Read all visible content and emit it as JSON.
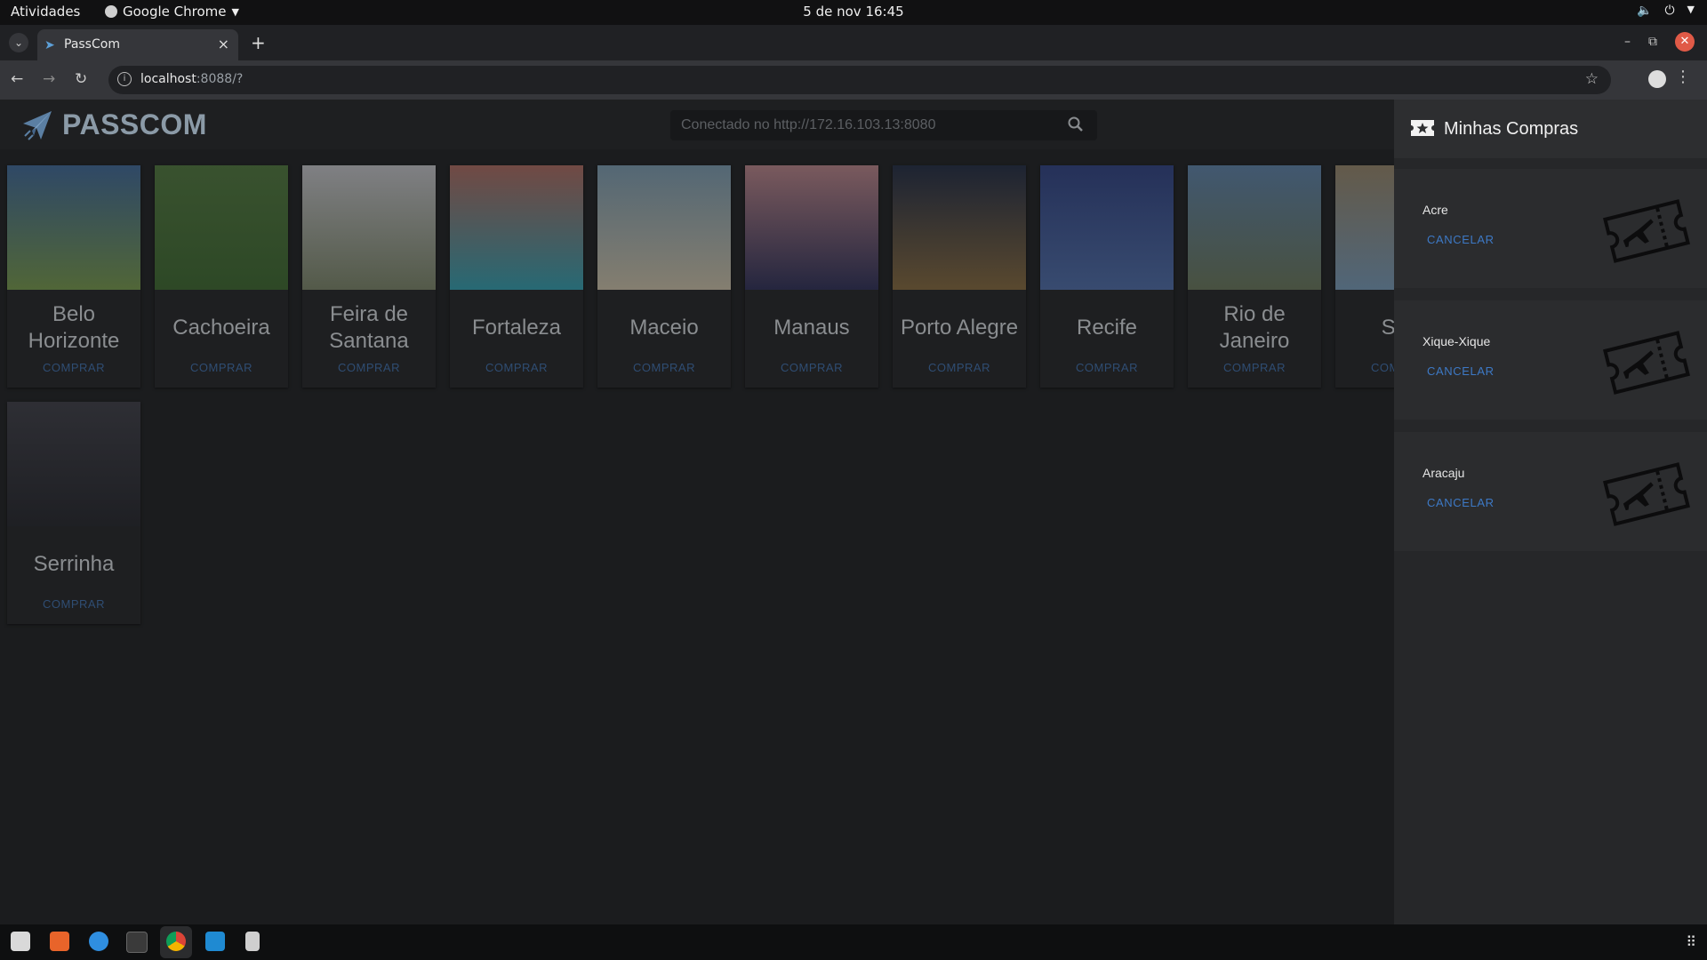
{
  "system_bar": {
    "activities": "Atividades",
    "app_name": "Google Chrome",
    "clock": "5 de nov  16:45"
  },
  "browser": {
    "tab_title": "PassCom",
    "url_host": "localhost",
    "url_rest": ":8088/?"
  },
  "app": {
    "brand": "PASSCOM",
    "search_placeholder": "Conectado no http://172.16.103.13:8080",
    "buy_label": "COMPRAR",
    "cities": [
      {
        "name": "Belo Horizonte",
        "top": "#3d6a9e",
        "bottom": "#7aa04a"
      },
      {
        "name": "Cachoeira",
        "top": "#4f7b3a",
        "bottom": "#3a6a2a"
      },
      {
        "name": "Feira de Santana",
        "top": "#cfcfd4",
        "bottom": "#7f8a6a"
      },
      {
        "name": "Fortaleza",
        "top": "#b56c60",
        "bottom": "#2fa6b8"
      },
      {
        "name": "Maceio",
        "top": "#7fa2b8",
        "bottom": "#d8ccb0"
      },
      {
        "name": "Manaus",
        "top": "#c58a8f",
        "bottom": "#2a2b57"
      },
      {
        "name": "Porto Alegre",
        "top": "#1c2741",
        "bottom": "#8a6b3a"
      },
      {
        "name": "Recife",
        "top": "#2b3f86",
        "bottom": "#4d6fb0"
      },
      {
        "name": "Rio de Janeiro",
        "top": "#5e86b0",
        "bottom": "#6b7a5a"
      },
      {
        "name": "Salv",
        "top": "#9c8a6b",
        "bottom": "#7aa0c0"
      },
      {
        "name": "Serrinha",
        "top": "#3b3b44",
        "bottom": "#1f2026"
      }
    ]
  },
  "drawer": {
    "title": "Minhas Compras",
    "cancel_label": "CANCELAR",
    "purchases": [
      {
        "name": "Acre"
      },
      {
        "name": "Xique-Xique"
      },
      {
        "name": "Aracaju"
      }
    ]
  },
  "colors": {
    "accent": "#3d79c5",
    "buy_link": "#2f4d73",
    "brand": "#8b9aa7"
  }
}
